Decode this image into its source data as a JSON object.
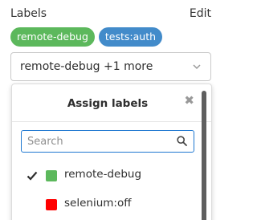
{
  "header": {
    "title": "Labels",
    "edit_label": "Edit"
  },
  "selected_badges": [
    {
      "label": "remote-debug",
      "color": "#5cb85c"
    },
    {
      "label": "tests:auth",
      "color": "#428bca"
    }
  ],
  "dropdown": {
    "button_text": "remote-debug +1 more",
    "chevron_icon": "chevron-down-icon"
  },
  "panel": {
    "title": "Assign labels",
    "close_icon": "close-icon",
    "search": {
      "placeholder": "Search",
      "value": "",
      "icon": "search-icon"
    },
    "items": [
      {
        "label": "remote-debug",
        "color": "#5cb85c",
        "checked": true
      },
      {
        "label": "selenium:off",
        "color": "#ff0000",
        "checked": false
      }
    ]
  },
  "colors": {
    "focus_border": "#1f78d1"
  }
}
